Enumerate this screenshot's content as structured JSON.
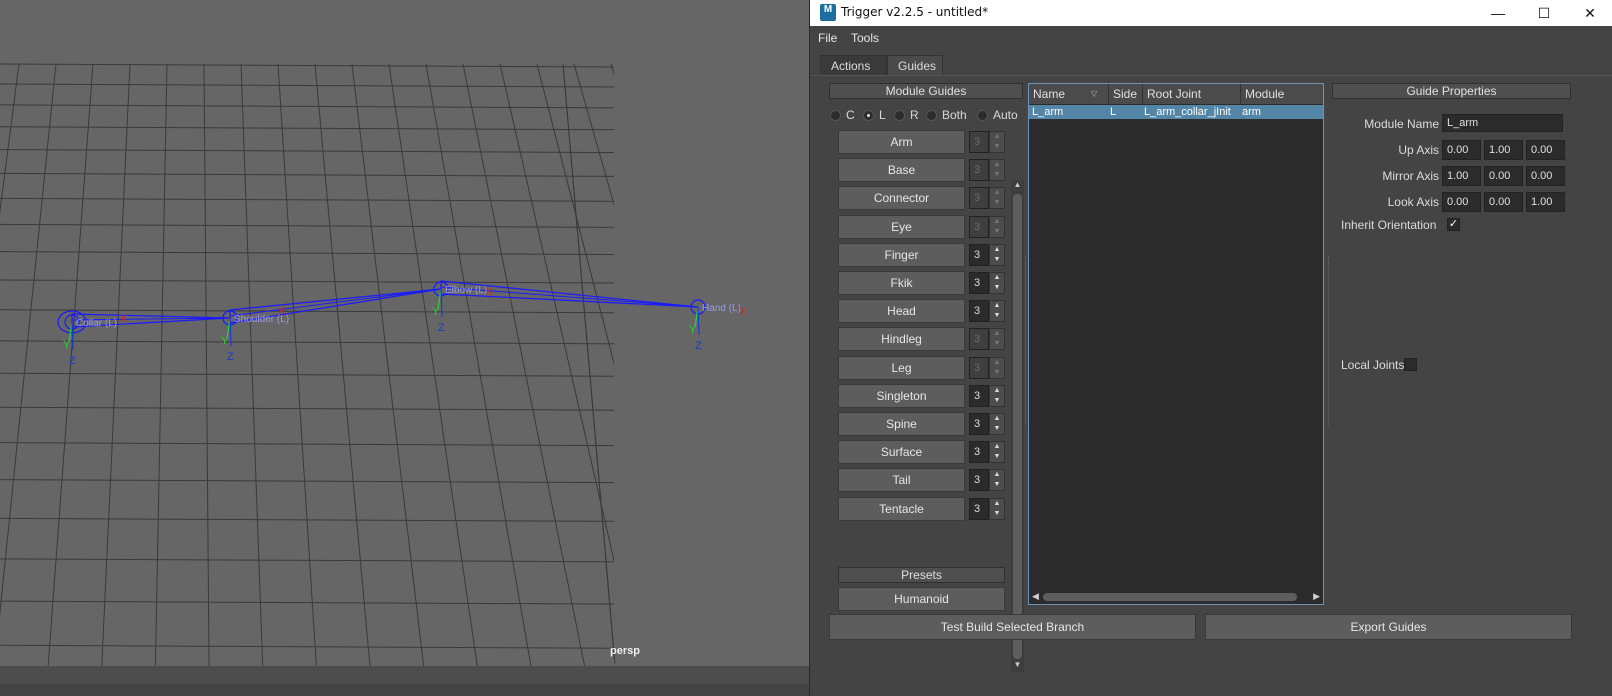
{
  "viewport": {
    "camera_label": "persp",
    "joints": [
      {
        "name": "Collar (L)"
      },
      {
        "name": "Shoulder (L)"
      },
      {
        "name": "Elbow (L)"
      },
      {
        "name": "Hand (L)"
      }
    ],
    "axis_letters": {
      "x": "X",
      "y": "Y",
      "z": "Z"
    },
    "colors": {
      "background": "#666666",
      "grid": "#3a3a3a",
      "bones": "#1a1aff",
      "x_axis": "#cc2a2a",
      "y_axis": "#2ad52a",
      "z_axis": "#1a3ad0"
    }
  },
  "window": {
    "icon_letter": "M",
    "title": "Trigger v2.2.5 - untitled*",
    "controls": {
      "minimize": "—",
      "maximize": "☐",
      "close": "✕"
    },
    "menu": [
      "File",
      "Tools"
    ],
    "tabs": [
      "Actions",
      "Guides"
    ],
    "active_tab": "Guides"
  },
  "module_guides": {
    "header": "Module Guides",
    "side_options": [
      {
        "label": "C",
        "selected": false
      },
      {
        "label": "L",
        "selected": true
      },
      {
        "label": "R",
        "selected": false
      },
      {
        "label": "Both",
        "selected": false
      },
      {
        "label": "Auto",
        "selected": false
      }
    ],
    "modules": [
      {
        "label": "Arm",
        "count": "3",
        "enabled": false
      },
      {
        "label": "Base",
        "count": "3",
        "enabled": false
      },
      {
        "label": "Connector",
        "count": "3",
        "enabled": false
      },
      {
        "label": "Eye",
        "count": "3",
        "enabled": false
      },
      {
        "label": "Finger",
        "count": "3",
        "enabled": true
      },
      {
        "label": "Fkik",
        "count": "3",
        "enabled": true
      },
      {
        "label": "Head",
        "count": "3",
        "enabled": true
      },
      {
        "label": "Hindleg",
        "count": "3",
        "enabled": false
      },
      {
        "label": "Leg",
        "count": "3",
        "enabled": false
      },
      {
        "label": "Singleton",
        "count": "3",
        "enabled": true
      },
      {
        "label": "Spine",
        "count": "3",
        "enabled": true
      },
      {
        "label": "Surface",
        "count": "3",
        "enabled": true
      },
      {
        "label": "Tail",
        "count": "3",
        "enabled": true
      },
      {
        "label": "Tentacle",
        "count": "3",
        "enabled": true
      }
    ],
    "presets_header": "Presets",
    "presets": [
      "Humanoid"
    ]
  },
  "guide_tree": {
    "columns": [
      "Name",
      "Side",
      "Root Joint",
      "Module"
    ],
    "rows": [
      {
        "name": "L_arm",
        "side": "L",
        "root_joint": "L_arm_collar_jInit",
        "module": "arm",
        "selected": true
      }
    ]
  },
  "guide_properties": {
    "header": "Guide Properties",
    "module_name_label": "Module Name",
    "module_name": "L_arm",
    "axes": [
      {
        "label": "Up Axis",
        "values": [
          "0.00",
          "1.00",
          "0.00"
        ]
      },
      {
        "label": "Mirror Axis",
        "values": [
          "1.00",
          "0.00",
          "0.00"
        ]
      },
      {
        "label": "Look Axis",
        "values": [
          "0.00",
          "0.00",
          "1.00"
        ]
      }
    ],
    "inherit_orientation_label": "Inherit Orientation",
    "inherit_orientation": true,
    "local_joints_label": "Local Joints",
    "local_joints": false
  },
  "footer": {
    "test_build_label": "Test Build Selected Branch",
    "export_label": "Export Guides"
  }
}
